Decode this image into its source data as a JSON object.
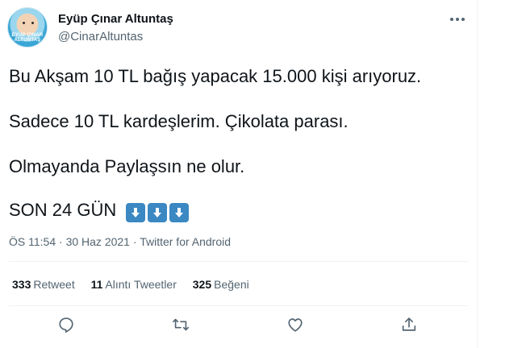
{
  "author": {
    "display_name": "Eyüp Çınar Altuntaş",
    "handle": "@CinarAltuntas",
    "avatar_text": "EYÜP ÇINAR ALTUNTAŞ"
  },
  "tweet": {
    "lines": [
      "Bu Akşam 10 TL bağış yapacak 15.000 kişi arıyoruz.",
      "Sadece 10 TL kardeşlerim. Çikolata parası.",
      "Olmayanda Paylaşsın ne olur.",
      "SON 24 GÜN"
    ],
    "emoji_icons": [
      "down-arrow-button-icon",
      "down-arrow-button-icon",
      "down-arrow-button-icon"
    ]
  },
  "meta": {
    "time": "ÖS 11:54",
    "date": "30 Haz 2021",
    "separator": "·",
    "source": "Twitter for Android"
  },
  "stats": {
    "retweets_count": "333",
    "retweets_label": "Retweet",
    "quotes_count": "11",
    "quotes_label": "Alıntı Tweetler",
    "likes_count": "325",
    "likes_label": "Beğeni"
  },
  "colors": {
    "text_primary": "#0f1419",
    "text_secondary": "#536471",
    "divider": "#eff3f4",
    "emoji_blue": "#3b88c3"
  }
}
